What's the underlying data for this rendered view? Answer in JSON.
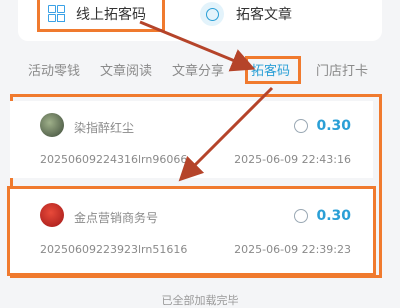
{
  "top_menu": {
    "online_qr_label": "线上拓客码",
    "article_label": "拓客文章"
  },
  "tabs": [
    "活动零钱",
    "文章阅读",
    "文章分享",
    "拓客码",
    "门店打卡"
  ],
  "active_tab": "拓客码",
  "records": [
    {
      "name": "染指醉红尘",
      "amount": "0.30",
      "code": "20250609224316lrn96066",
      "time": "2025-06-09 22:43:16"
    },
    {
      "name": "金点营销商务号",
      "amount": "0.30",
      "code": "20250609223923lrn51616",
      "time": "2025-06-09 22:39:23"
    }
  ],
  "footer": "已全部加载完毕",
  "colors": {
    "accent_blue": "#2a9fd6",
    "highlight_orange": "#f07a2e",
    "arrow": "#b5442a"
  }
}
